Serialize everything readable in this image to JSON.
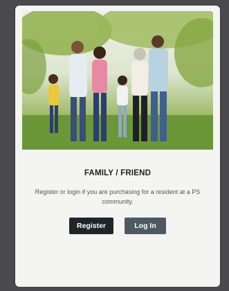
{
  "card": {
    "title": "FAMILY / FRIEND",
    "description": "Register or login if you are purchasing for a resident at a PS community.",
    "register_label": "Register",
    "login_label": "Log In"
  },
  "colors": {
    "register_button": "#1f262b",
    "login_button": "#4d5a63",
    "card_background": "#f4f4f3",
    "page_background": "#4a4a4c"
  }
}
